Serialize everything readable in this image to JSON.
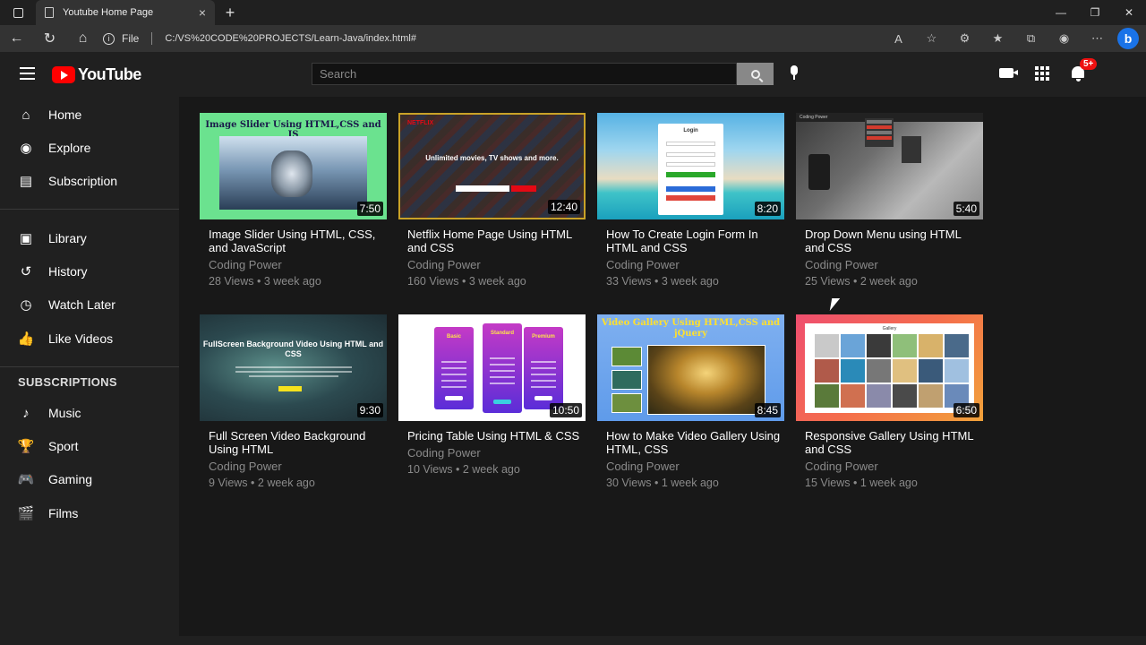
{
  "browser": {
    "tab_title": "Youtube Home Page",
    "new_tab": "+",
    "close_tab": "×",
    "protocol": "File",
    "url": "C:/VS%20CODE%20PROJECTS/Learn-Java/index.html#",
    "bing": "b"
  },
  "header": {
    "logo": "YouTube",
    "search_placeholder": "Search",
    "notifications_badge": "5+"
  },
  "sidebar": {
    "primary": [
      {
        "label": "Home",
        "icon": "home-icon"
      },
      {
        "label": "Explore",
        "icon": "compass-icon"
      },
      {
        "label": "Subscription",
        "icon": "subscriptions-icon"
      }
    ],
    "secondary": [
      {
        "label": "Library",
        "icon": "library-icon"
      },
      {
        "label": "History",
        "icon": "history-icon"
      },
      {
        "label": "Watch Later",
        "icon": "clock-icon"
      },
      {
        "label": "Like Videos",
        "icon": "thumbs-up-icon"
      }
    ],
    "subscriptions_heading": "SUBSCRIPTIONS",
    "subscriptions": [
      {
        "label": "Music",
        "icon": "music-note-icon"
      },
      {
        "label": "Sport",
        "icon": "trophy-icon"
      },
      {
        "label": "Gaming",
        "icon": "gamepad-icon"
      },
      {
        "label": "Films",
        "icon": "film-icon"
      }
    ]
  },
  "videos": [
    {
      "title": "Image Slider Using HTML, CSS, and JavaScript",
      "channel": "Coding Power",
      "views": "28 Views",
      "age": "3 week ago",
      "duration": "7:50",
      "thumb_text": "Image Slider Using HTML,CSS and JS"
    },
    {
      "title": "Netflix Home Page Using HTML and CSS",
      "channel": "Coding Power",
      "views": "160 Views",
      "age": "3 week ago",
      "duration": "12:40",
      "thumb_text": "Unlimited movies, TV shows and more."
    },
    {
      "title": "How To Create Login Form In HTML and CSS",
      "channel": "Coding Power",
      "views": "33 Views",
      "age": "3 week ago",
      "duration": "8:20",
      "thumb_text": "Login"
    },
    {
      "title": "Drop Down Menu using HTML and CSS",
      "channel": "Coding Power",
      "views": "25 Views",
      "age": "2 week ago",
      "duration": "5:40",
      "thumb_text": "Coding Power"
    },
    {
      "title": "Full Screen Video Background Using HTML",
      "channel": "Coding Power",
      "views": "9 Views",
      "age": "2 week ago",
      "duration": "9:30",
      "thumb_text": "FullScreen Background Video Using HTML and CSS"
    },
    {
      "title": "Pricing Table Using HTML & CSS",
      "channel": "Coding Power",
      "views": "10 Views",
      "age": "2 week ago",
      "duration": "10:50",
      "thumb_plans": [
        "Basic",
        "Standard",
        "Premium"
      ]
    },
    {
      "title": "How to Make Video Gallery Using HTML, CSS",
      "channel": "Coding Power",
      "views": "30 Views",
      "age": "1 week ago",
      "duration": "8:45",
      "thumb_text": "Video Gallery Using HTML,CSS and jQuery"
    },
    {
      "title": "Responsive Gallery Using HTML and CSS",
      "channel": "Coding Power",
      "views": "15 Views",
      "age": "1 week ago",
      "duration": "6:50",
      "thumb_text": "Gallery"
    }
  ],
  "meta_separator": "•",
  "colors": {
    "brand_red": "#ff0000",
    "bg": "#181818",
    "panel": "#202020",
    "muted_text": "#8a8a8a"
  }
}
